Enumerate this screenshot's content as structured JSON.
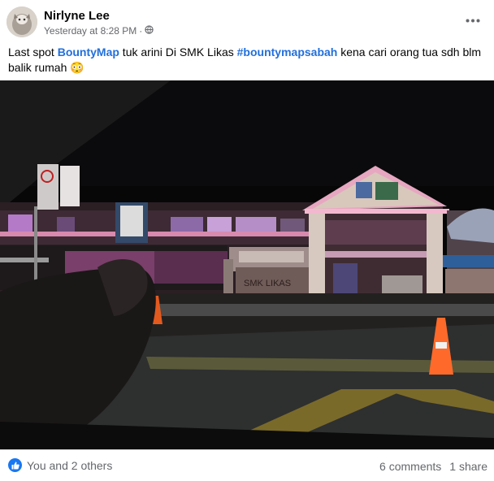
{
  "post": {
    "author": "Nirlyne Lee",
    "timestamp": "Yesterday at 8:28 PM",
    "separator": "·",
    "privacy_icon": "globe-icon",
    "more_icon": "more-horizontal-icon",
    "text_parts": {
      "p1": "Last spot ",
      "link1": "BountyMap",
      "p2": " tuk arini Di SMK Likas ",
      "link2": "#bountymapsabah",
      "p3": " kena cari orang tua sdh blm balik rumah",
      "emoji": "😳"
    }
  },
  "photo": {
    "sign_text": "SMK LIKAS",
    "caption_label": "school-entrance-photo"
  },
  "footer": {
    "reactions_text": "You and 2 others",
    "comments": "6 comments",
    "shares": "1 share"
  },
  "colors": {
    "link": "#216fdb",
    "meta": "#65676b",
    "like_badge": "#1877f2"
  }
}
